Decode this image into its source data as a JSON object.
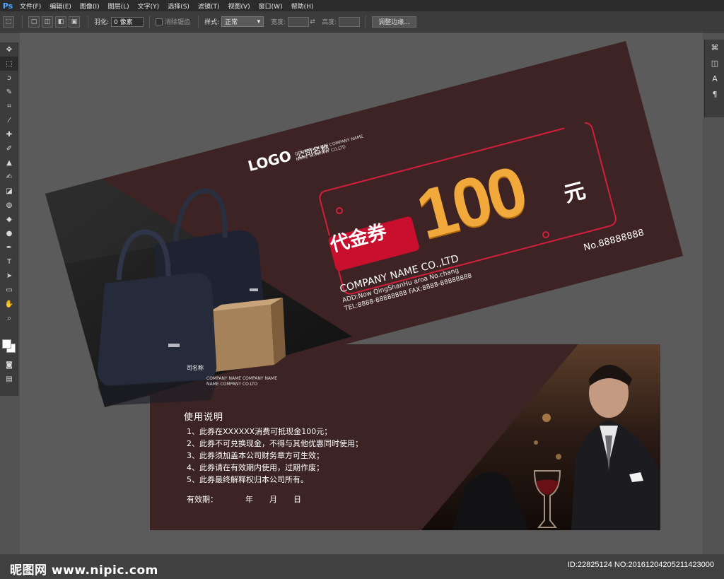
{
  "app": {
    "logo": "Ps"
  },
  "menu": [
    "文件(F)",
    "编辑(E)",
    "图像(I)",
    "图层(L)",
    "文字(Y)",
    "选择(S)",
    "滤镜(T)",
    "视图(V)",
    "窗口(W)",
    "帮助(H)"
  ],
  "options": {
    "feather_label": "羽化:",
    "feather_value": "0 像素",
    "antialias_label": "消除锯齿",
    "style_label": "样式:",
    "style_value": "正常",
    "width_label": "宽度:",
    "height_label": "高度:",
    "refine_button": "调整边缘..."
  },
  "coupon_front": {
    "logo": "LOGO",
    "company_cn": "公司名称",
    "company_en_1": "COMPANY NAME COMPANY NAME",
    "company_en_2": "NAME COMPANY CO.LTD",
    "badge": "代金券",
    "amount": "100",
    "unit": "元",
    "number": "No.88888888",
    "company_name": "COMPANY NAME CO.,LTD",
    "address": "ADD:Now QingShanHu aroa No.chang",
    "tel_fax": "TEL:8888-88888888  FAX:8888-88888888"
  },
  "coupon_back": {
    "logo_partial": "司名称",
    "company_en_1": "COMPANY NAME COMPANY NAME",
    "company_en_2": "NAME COMPANY CO.LTD",
    "title": "使用说明",
    "rules": [
      "1、此券在XXXXXX消费可抵现金100元；",
      "2、此券不可兑换现金，不得与其他优惠同时使用；",
      "3、此券须加盖本公司财务章方可生效；",
      "4、此券请在有效期内使用，过期作废；",
      "5、此券最终解释权归本公司所有。"
    ],
    "valid_label": "有效期：",
    "year": "年",
    "month": "月",
    "day": "日"
  },
  "watermark": {
    "site": "昵图网 www.nipic.com",
    "id": "ID:22825124 NO:20161204205211423000"
  },
  "colors": {
    "coupon_brown": "#3d2323",
    "badge_red": "#c8102e",
    "gold": "#f0a93a",
    "frame_red": "#d31f3c"
  }
}
